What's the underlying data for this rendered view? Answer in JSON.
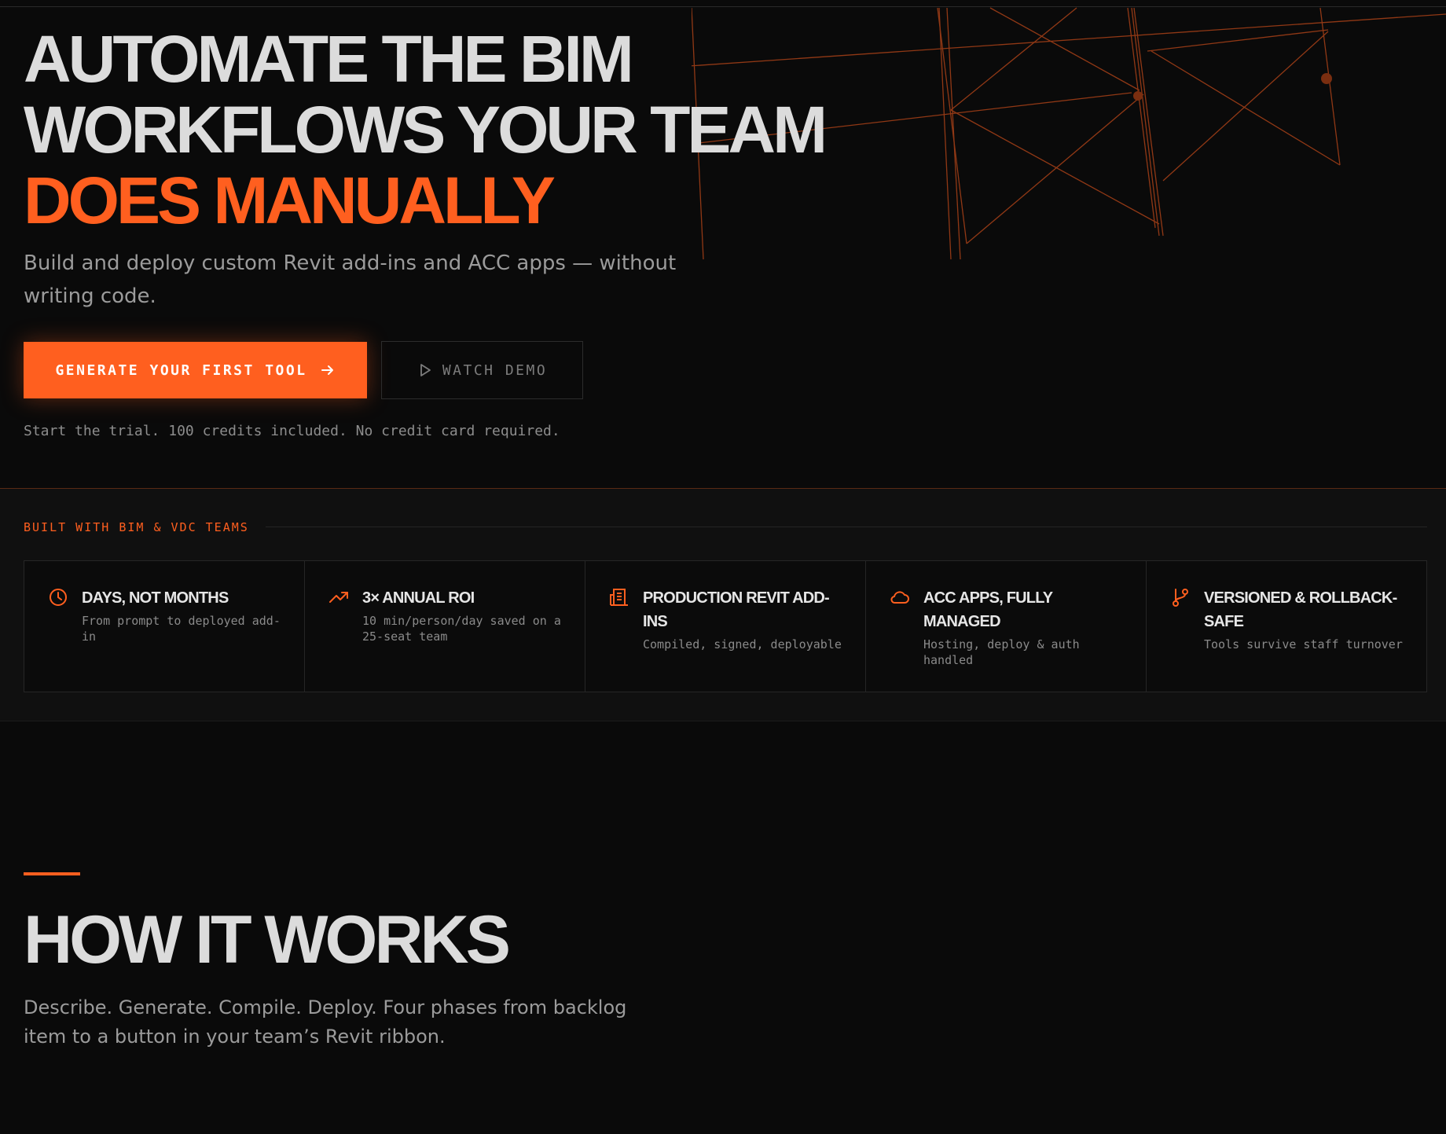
{
  "hero": {
    "title_line1": "AUTOMATE THE BIM",
    "title_line2": "WORKFLOWS YOUR TEAM",
    "title_line3": "DOES MANUALLY",
    "subtitle": "Build and deploy custom Revit add-ins and ACC apps — without writing code.",
    "primary_button": "GENERATE YOUR FIRST TOOL",
    "secondary_button": "WATCH DEMO",
    "trial_note": "Start the trial. 100 credits included. No credit card required."
  },
  "social_proof": {
    "heading": "BUILT WITH BIM & VDC TEAMS",
    "features": [
      {
        "icon": "clock-icon",
        "title": "DAYS, NOT MONTHS",
        "description": "From prompt to deployed add-in"
      },
      {
        "icon": "trending-up-icon",
        "title": "3× ANNUAL ROI",
        "description": "10 min/person/day saved on a 25-seat team"
      },
      {
        "icon": "building-icon",
        "title": "PRODUCTION REVIT ADD-INS",
        "description": "Compiled, signed, deployable"
      },
      {
        "icon": "cloud-icon",
        "title": "ACC APPS, FULLY MANAGED",
        "description": "Hosting, deploy & auth handled"
      },
      {
        "icon": "git-branch-icon",
        "title": "VERSIONED & ROLLBACK-SAFE",
        "description": "Tools survive staff turnover"
      }
    ]
  },
  "how_it_works": {
    "title": "HOW IT WORKS",
    "subtitle": "Describe. Generate. Compile. Deploy. Four phases from backlog item to a button in your team’s Revit ribbon."
  },
  "colors": {
    "background": "#0a0a0a",
    "band_background": "#101010",
    "accent": "#ff5f1f",
    "heading_text": "#dcdcdc",
    "muted_text": "#9b9b9b"
  }
}
